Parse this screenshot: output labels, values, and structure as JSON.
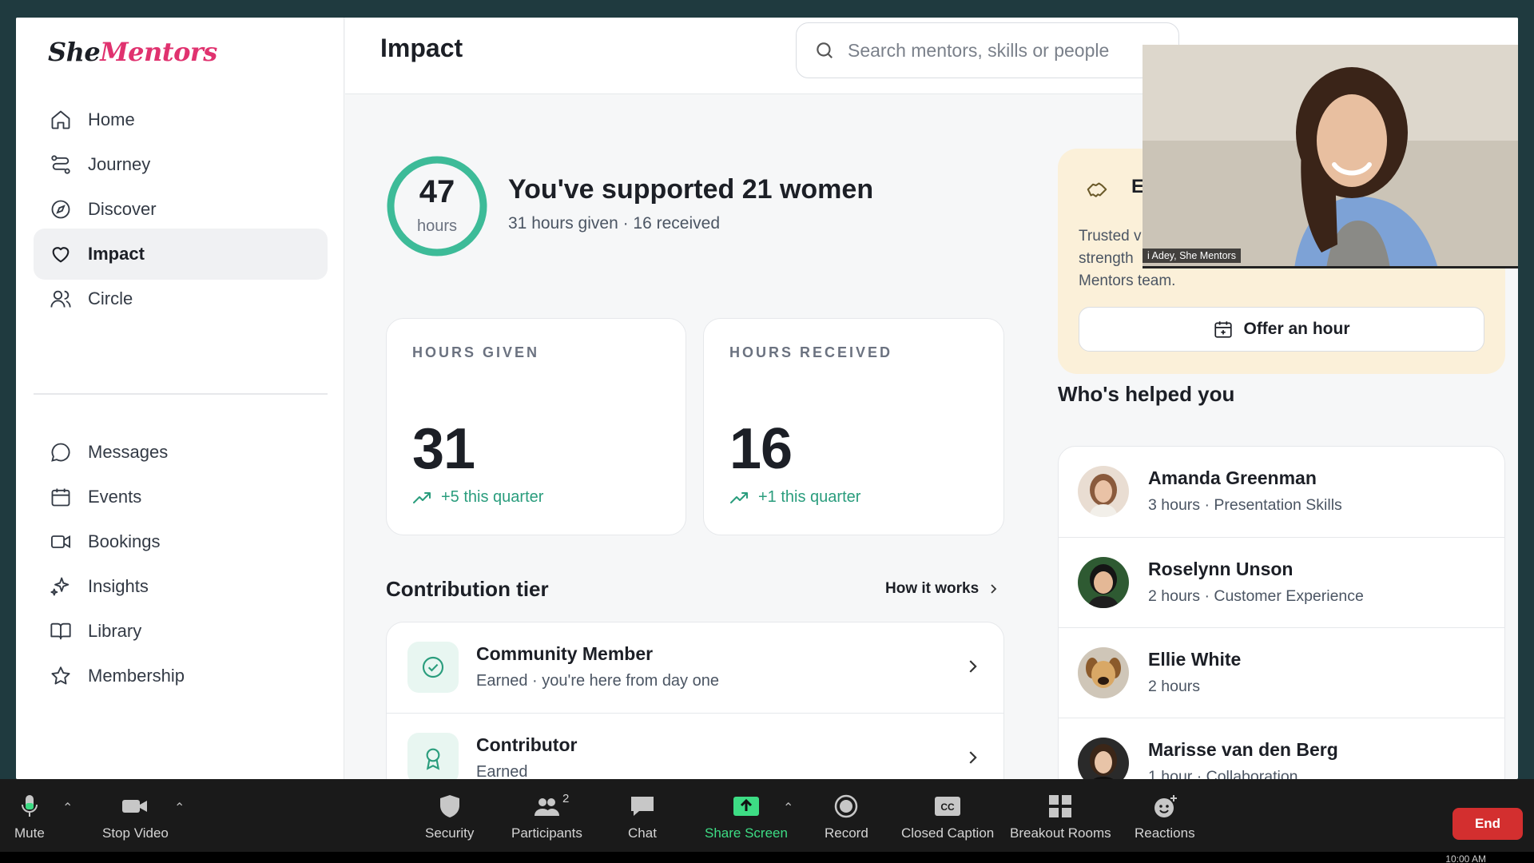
{
  "brand": {
    "part1": "She",
    "part2": "Mentors"
  },
  "sidebar": {
    "items": [
      {
        "label": "Home",
        "icon": "home-icon"
      },
      {
        "label": "Journey",
        "icon": "route-icon"
      },
      {
        "label": "Discover",
        "icon": "compass-icon"
      },
      {
        "label": "Impact",
        "icon": "heart-icon",
        "active": true
      },
      {
        "label": "Circle",
        "icon": "users-icon"
      },
      {
        "label": "Messages",
        "icon": "message-icon"
      },
      {
        "label": "Events",
        "icon": "calendar-icon"
      },
      {
        "label": "Bookings",
        "icon": "video-icon"
      },
      {
        "label": "Insights",
        "icon": "sparkle-icon"
      },
      {
        "label": "Library",
        "icon": "book-icon"
      },
      {
        "label": "Membership",
        "icon": "star-icon"
      }
    ]
  },
  "header": {
    "title": "Impact",
    "search_placeholder": "Search mentors, skills or people"
  },
  "hero": {
    "hours_total": "47",
    "hours_unit": "hours",
    "ring_progress": 1.0,
    "title": "You've supported 21 women",
    "subtitle": "31 hours given · 16 received"
  },
  "stats": {
    "given": {
      "label": "HOURS GIVEN",
      "value": "31",
      "trend": "+5 this quarter"
    },
    "received": {
      "label": "HOURS RECEIVED",
      "value": "16",
      "trend": "+1 this quarter"
    }
  },
  "tier": {
    "title": "Contribution tier",
    "how_link": "How it works",
    "rows": [
      {
        "name": "Community Member",
        "desc": "Earned · you're here from day one",
        "icon": "check-circle-icon"
      },
      {
        "name": "Contributor",
        "desc": "Earned",
        "icon": "award-icon"
      }
    ]
  },
  "offer": {
    "heading_visible": "E",
    "text": "Trusted v strength Mentors team.",
    "text_line1": "Trusted v",
    "text_line2": "strength",
    "text_line3": "Mentors team.",
    "button": "Offer an hour"
  },
  "helped": {
    "title": "Who's helped you",
    "people": [
      {
        "name": "Amanda Greenman",
        "meta": "3 hours · Presentation Skills"
      },
      {
        "name": "Roselynn Unson",
        "meta": "2 hours · Customer Experience"
      },
      {
        "name": "Ellie White",
        "meta": "2 hours"
      },
      {
        "name": "Marisse van den Berg",
        "meta": "1 hour · Collaboration"
      }
    ]
  },
  "video": {
    "name_tag": "i Adey, She Mentors"
  },
  "zoom": {
    "mute": "Mute",
    "stop_video": "Stop Video",
    "security": "Security",
    "participants": "Participants",
    "participants_count": "2",
    "chat": "Chat",
    "share": "Share Screen",
    "record": "Record",
    "cc": "Closed Caption",
    "breakout": "Breakout Rooms",
    "reactions": "Reactions",
    "end": "End",
    "clock": "10:00 AM"
  },
  "colors": {
    "accent": "#2a9d7d",
    "brand_pink": "#e0326f",
    "offer_bg": "#fbf0d9",
    "end_red": "#d32f2f",
    "share_green": "#3ddc84"
  }
}
